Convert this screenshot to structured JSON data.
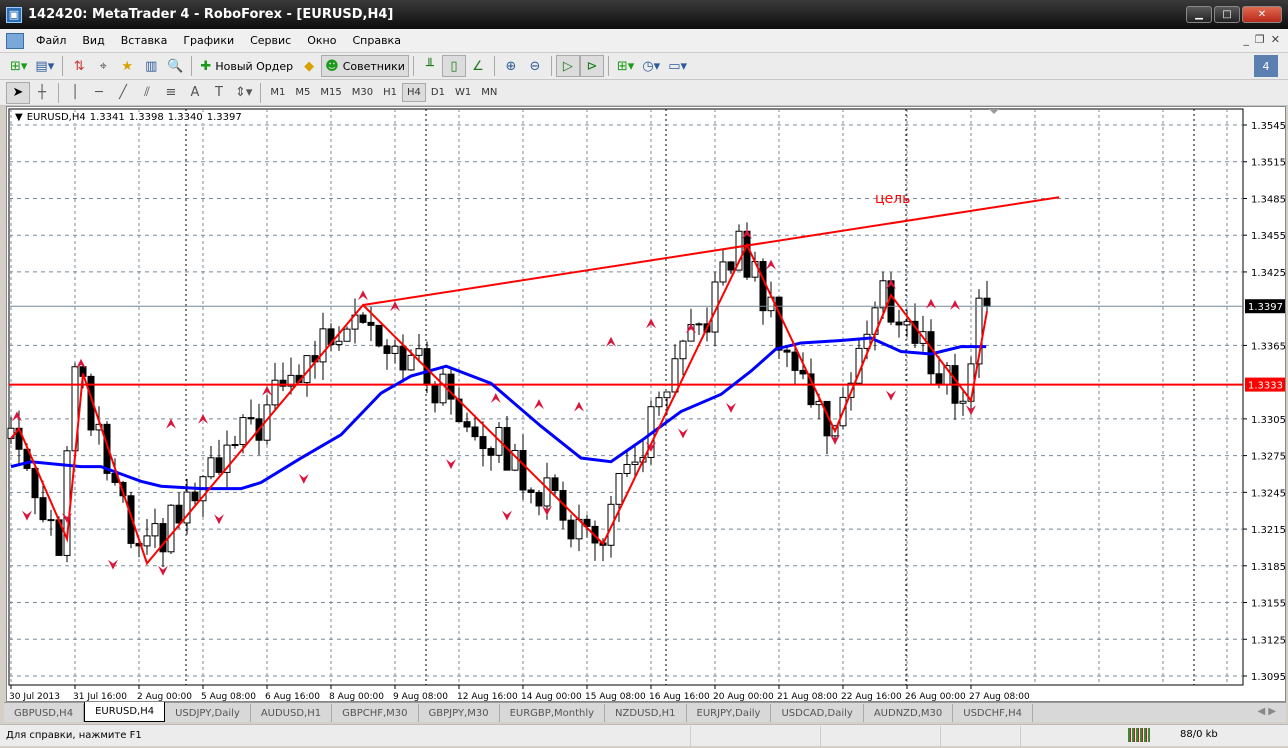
{
  "window": {
    "title": "142420: MetaTrader 4 - RoboForex - [EURUSD,H4]",
    "controls": [
      "minimize",
      "maximize",
      "close"
    ]
  },
  "menu": [
    "Файл",
    "Вид",
    "Вставка",
    "Графики",
    "Сервис",
    "Окно",
    "Справка"
  ],
  "toolbar": {
    "new_order_label": "Новый Ордер",
    "experts_label": "Советники"
  },
  "timeframes": [
    "M1",
    "M5",
    "M15",
    "M30",
    "H1",
    "H4",
    "D1",
    "W1",
    "MN"
  ],
  "active_timeframe": "H4",
  "chart_header": {
    "symbol": "EURUSD,H4",
    "open": "1.3341",
    "high": "1.3398",
    "low": "1.3340",
    "close": "1.3397"
  },
  "colors": {
    "zigzag": "#ff0000",
    "ma": "#0000ff",
    "level": "#ff0000",
    "fractal": "#dc143c",
    "bull": "#ffffff",
    "bear": "#000000"
  },
  "chart_data": {
    "type": "candlestick",
    "symbol": "EURUSD",
    "timeframe": "H4",
    "ylim": [
      1.308,
      1.356
    ],
    "price_ticks": [
      "1.3545",
      "1.3515",
      "1.3485",
      "1.3455",
      "1.3425",
      "1.3365",
      "1.3305",
      "1.3275",
      "1.3245",
      "1.3215",
      "1.3185",
      "1.3155",
      "1.3125",
      "1.3095"
    ],
    "time_ticks": [
      "30 Jul 2013",
      "31 Jul 16:00",
      "2 Aug 00:00",
      "5 Aug 08:00",
      "6 Aug 16:00",
      "8 Aug 00:00",
      "9 Aug 08:00",
      "12 Aug 16:00",
      "14 Aug 00:00",
      "15 Aug 08:00",
      "16 Aug 16:00",
      "20 Aug 00:00",
      "21 Aug 08:00",
      "22 Aug 16:00",
      "26 Aug 00:00",
      "27 Aug 08:00"
    ],
    "bars_per_time_tick": 8,
    "bar_count": 123,
    "current_price": "1.3397",
    "horizontal_level": "1.3333",
    "target_label": "цель",
    "target_line": [
      [
        44,
        1.3398
      ],
      [
        131,
        1.3486
      ]
    ],
    "zigzag": [
      [
        0,
        1.3289
      ],
      [
        1,
        1.3297
      ],
      [
        7,
        1.3207
      ],
      [
        9,
        1.3342
      ],
      [
        17,
        1.3187
      ],
      [
        44,
        1.3398
      ],
      [
        74,
        1.3203
      ],
      [
        92,
        1.3447
      ],
      [
        103,
        1.3295
      ],
      [
        110,
        1.3406
      ],
      [
        120,
        1.332
      ],
      [
        122,
        1.3393
      ]
    ],
    "moving_average": [
      [
        0,
        1.3266
      ],
      [
        2.5,
        1.327
      ],
      [
        8.75,
        1.3266
      ],
      [
        11.25,
        1.3266
      ],
      [
        16.25,
        1.3254
      ],
      [
        18.75,
        1.325
      ],
      [
        23.75,
        1.3248
      ],
      [
        28.75,
        1.3248
      ],
      [
        31.25,
        1.3253
      ],
      [
        36.25,
        1.3273
      ],
      [
        41.25,
        1.3292
      ],
      [
        46.25,
        1.3326
      ],
      [
        50,
        1.334
      ],
      [
        54.4,
        1.3348
      ],
      [
        60,
        1.3334
      ],
      [
        66.25,
        1.3299
      ],
      [
        71.25,
        1.3273
      ],
      [
        75,
        1.327
      ],
      [
        78.75,
        1.3287
      ],
      [
        83.75,
        1.3311
      ],
      [
        88.75,
        1.3325
      ],
      [
        92.5,
        1.3344
      ],
      [
        95.6,
        1.3362
      ],
      [
        98.75,
        1.3367
      ],
      [
        103.75,
        1.3369
      ],
      [
        107.5,
        1.3371
      ],
      [
        111.25,
        1.336
      ],
      [
        115,
        1.3358
      ],
      [
        118.75,
        1.3364
      ],
      [
        121.9,
        1.3364
      ]
    ],
    "fractals_up": [
      [
        0.75,
        1.3307
      ],
      [
        8.75,
        1.335
      ],
      [
        20,
        1.3301
      ],
      [
        24,
        1.3305
      ],
      [
        32,
        1.3328
      ],
      [
        44,
        1.3406
      ],
      [
        48,
        1.3397
      ],
      [
        60.6,
        1.3322
      ],
      [
        66,
        1.3317
      ],
      [
        71,
        1.3315
      ],
      [
        75,
        1.3368
      ],
      [
        80,
        1.3383
      ],
      [
        85,
        1.3379
      ],
      [
        92,
        1.3456
      ],
      [
        95,
        1.3431
      ],
      [
        110,
        1.3415
      ],
      [
        115,
        1.3399
      ],
      [
        118,
        1.3398
      ]
    ],
    "fractals_down": [
      [
        2,
        1.3226
      ],
      [
        7,
        1.3224
      ],
      [
        12.75,
        1.3186
      ],
      [
        19,
        1.3181
      ],
      [
        26,
        1.3223
      ],
      [
        36.6,
        1.3256
      ],
      [
        55,
        1.3268
      ],
      [
        62,
        1.3226
      ],
      [
        67,
        1.323
      ],
      [
        80,
        1.3282
      ],
      [
        84,
        1.3293
      ],
      [
        90,
        1.3314
      ],
      [
        103,
        1.3288
      ],
      [
        110,
        1.3324
      ],
      [
        120,
        1.3312
      ]
    ]
  },
  "symbol_tabs": [
    "GBPUSD,H4",
    "EURUSD,H4",
    "USDJPY,Daily",
    "AUDUSD,H1",
    "GBPCHF,M30",
    "GBPJPY,M30",
    "EURGBP,Monthly",
    "NZDUSD,H1",
    "EURJPY,Daily",
    "USDCAD,Daily",
    "AUDNZD,M30",
    "USDCHF,H4"
  ],
  "active_tab": "EURUSD,H4",
  "status": {
    "help": "Для справки, нажмите F1",
    "traffic": "88/0 kb"
  }
}
